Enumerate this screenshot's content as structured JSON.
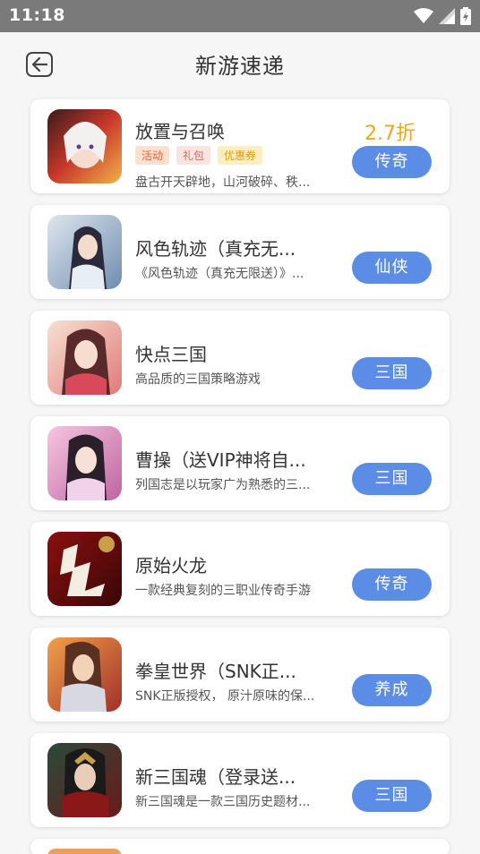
{
  "status_bar": {
    "time": "11:18"
  },
  "header": {
    "title": "新游速递"
  },
  "colors": {
    "accent": "#5b8ce6",
    "discount": "#f2a61a"
  },
  "games": [
    {
      "name": "放置与召唤",
      "discount": "2.7折",
      "tags": [
        "活动",
        "礼包",
        "优惠券"
      ],
      "desc": "盘古开天辟地，山河破碎、秩...",
      "category": "传奇"
    },
    {
      "name": "风色轨迹（真充无...",
      "desc": "《风色轨迹（真充无限送）》...",
      "category": "仙侠"
    },
    {
      "name": "快点三国",
      "desc": "高品质的三国策略游戏",
      "category": "三国"
    },
    {
      "name": "曹操（送VIP神将自...",
      "desc": "列国志是以玩家广为熟悉的三...",
      "category": "三国"
    },
    {
      "name": "原始火龙",
      "desc": "一款经典复刻的三职业传奇手游",
      "category": "传奇"
    },
    {
      "name": "拳皇世界（SNK正...",
      "desc": "SNK正版授权， 原汁原味的保...",
      "category": "养成"
    },
    {
      "name": "新三国魂（登录送...",
      "desc": "新三国魂是一款三国历史题材...",
      "category": "三国"
    }
  ]
}
